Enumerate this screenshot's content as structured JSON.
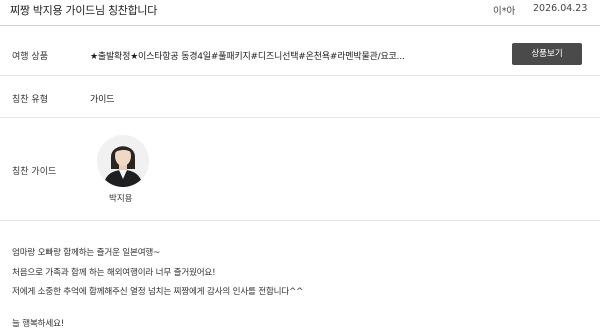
{
  "review": {
    "title": "찌짱 박지용 가이드님 칭찬합니다",
    "author": "이*아",
    "date": "2026.04.23"
  },
  "fields": {
    "product_label": "여행 상품",
    "product_value": "★출발확정★이스타항공 동경4일#풀패키지#디즈니선택#온천욕#라멘박물관/요코...",
    "product_button": "상품보기",
    "type_label": "칭찬 유형",
    "type_value": "가이드",
    "guide_label": "칭찬 가이드",
    "guide_name": "박지용"
  },
  "content": {
    "lines": [
      "엄마랑 오빠랑 함께하는 즐거운 일본여행~",
      "처음으로 가족과 함께 하는 해외여행이라 너무 즐거웠어요!",
      "저에게 소중한 추억에 함께해주신 열정 넘치는 찌짱에게 감사의 인사를 전합니다^^",
      "",
      "늘 행복하세요!"
    ]
  },
  "icons": {
    "avatar": "guide-avatar"
  }
}
